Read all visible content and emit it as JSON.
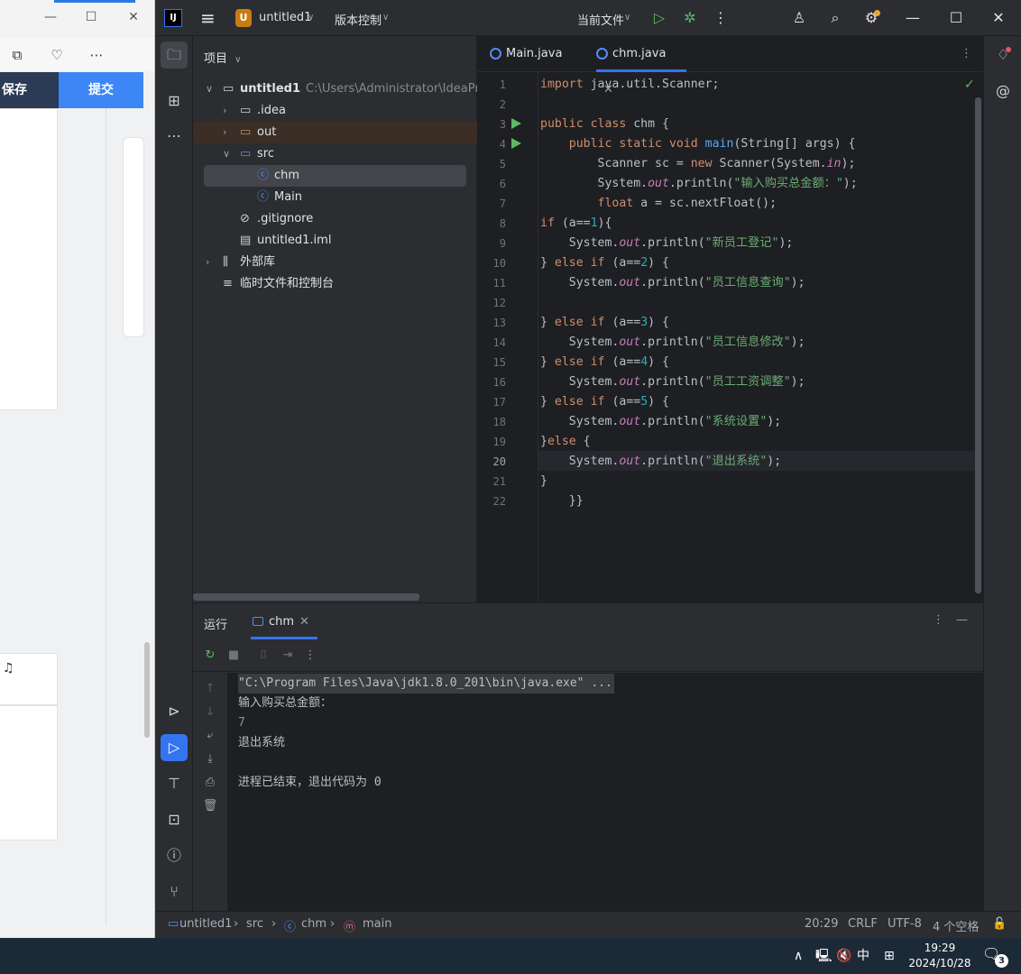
{
  "browser": {
    "save_label": "保存",
    "submit_label": "提交",
    "note_icon": "♫"
  },
  "ide": {
    "project_badge": "U",
    "project_name": "untitled1",
    "vcs_label": "版本控制",
    "run_config": "当前文件",
    "panel_title": "项目",
    "tree": [
      {
        "label": "untitled1",
        "path": "C:\\Users\\Administrator\\IdeaProjec",
        "kind": "module-folder"
      },
      {
        "label": ".idea",
        "kind": "folder"
      },
      {
        "label": "out",
        "kind": "folder"
      },
      {
        "label": "src",
        "kind": "source-folder"
      },
      {
        "label": "chm",
        "kind": "class"
      },
      {
        "label": "Main",
        "kind": "class"
      },
      {
        "label": ".gitignore",
        "kind": "ignore-file"
      },
      {
        "label": "untitled1.iml",
        "kind": "iml-file"
      },
      {
        "label": "外部库",
        "kind": "library"
      },
      {
        "label": "临时文件和控制台",
        "kind": "scratch"
      }
    ],
    "tabs": [
      {
        "label": "Main.java"
      },
      {
        "label": "chm.java"
      }
    ],
    "line_numbers": [
      "1",
      "2",
      "3",
      "4",
      "5",
      "6",
      "7",
      "8",
      "9",
      "10",
      "11",
      "12",
      "13",
      "14",
      "15",
      "16",
      "17",
      "18",
      "19",
      "20",
      "21",
      "22"
    ],
    "code_lines": [
      "import java.util.Scanner;",
      "",
      "public class chm {",
      "    public static void main(String[] args) {",
      "        Scanner sc = new Scanner(System.in);",
      "        System.out.println(\"输入购买总金额：\");",
      "        float a = sc.nextFloat();",
      "if (a==1){",
      "    System.out.println(\"新员工登记\");",
      "} else if (a==2) {",
      "    System.out.println(\"员工信息查询\");",
      "",
      "} else if (a==3) {",
      "    System.out.println(\"员工信息修改\");",
      "} else if (a==4) {",
      "    System.out.println(\"员工工资调整\");",
      "} else if (a==5) {",
      "    System.out.println(\"系统设置\");",
      "}else {",
      "    System.out.println(\"退出系统\");",
      "}",
      "    }}"
    ],
    "run_panel": {
      "title": "运行",
      "tab": "chm",
      "console": [
        "\"C:\\Program Files\\Java\\jdk1.8.0_201\\bin\\java.exe\" ...",
        "输入购买总金额：",
        "7",
        "退出系统",
        "",
        "进程已结束，退出代码为 0"
      ]
    },
    "breadcrumb": [
      "untitled1",
      "src",
      "chm",
      "main"
    ],
    "status": {
      "position": "20:29",
      "line_sep": "CRLF",
      "encoding": "UTF-8",
      "indent": "4 个空格"
    }
  },
  "taskbar": {
    "ime": "中",
    "time": "19:29",
    "date": "2024/10/28",
    "notifications": "3"
  }
}
